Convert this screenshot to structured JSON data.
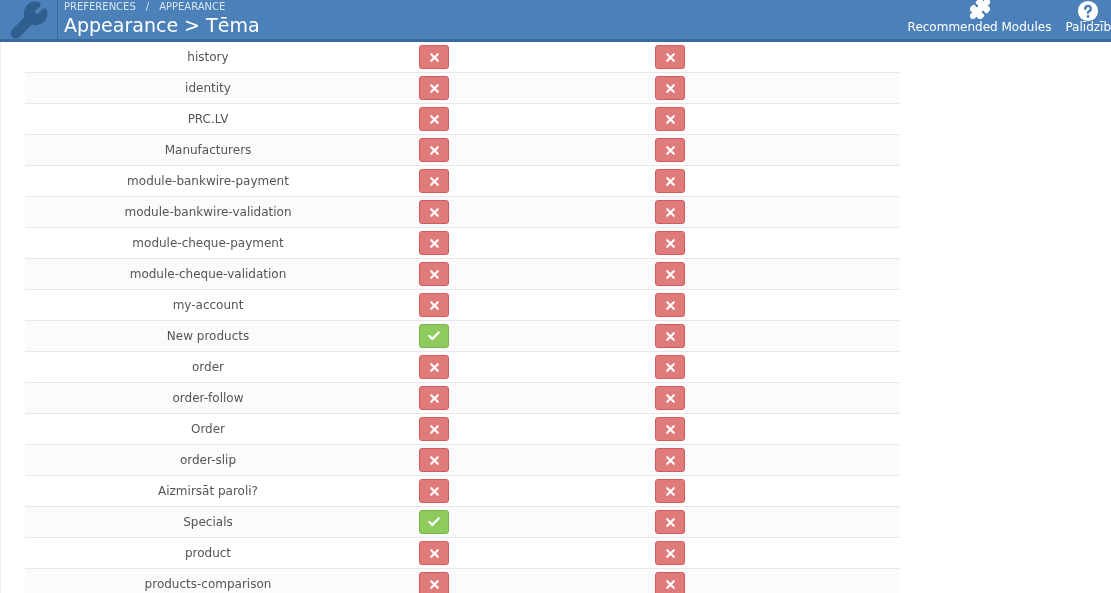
{
  "header": {
    "breadcrumb": [
      "PREFERENCES",
      "/",
      "APPEARANCE"
    ],
    "title": "Appearance > Tēma",
    "actions": [
      {
        "kind": "modules",
        "label": "Recommended Modules"
      },
      {
        "kind": "help",
        "label": "Palīdzīb"
      }
    ]
  },
  "rows": [
    {
      "name": "history",
      "toggles": [
        {
          "on": false
        },
        {
          "on": false
        }
      ]
    },
    {
      "name": "identity",
      "toggles": [
        {
          "on": false
        },
        {
          "on": false
        }
      ]
    },
    {
      "name": "PRC.LV",
      "toggles": [
        {
          "on": false
        },
        {
          "on": false
        }
      ]
    },
    {
      "name": "Manufacturers",
      "toggles": [
        {
          "on": false
        },
        {
          "on": false
        }
      ]
    },
    {
      "name": "module-bankwire-payment",
      "toggles": [
        {
          "on": false
        },
        {
          "on": false
        }
      ]
    },
    {
      "name": "module-bankwire-validation",
      "toggles": [
        {
          "on": false
        },
        {
          "on": false
        }
      ]
    },
    {
      "name": "module-cheque-payment",
      "toggles": [
        {
          "on": false
        },
        {
          "on": false
        }
      ]
    },
    {
      "name": "module-cheque-validation",
      "toggles": [
        {
          "on": false
        },
        {
          "on": false
        }
      ]
    },
    {
      "name": "my-account",
      "toggles": [
        {
          "on": false
        },
        {
          "on": false
        }
      ]
    },
    {
      "name": "New products",
      "toggles": [
        {
          "on": true
        },
        {
          "on": false
        }
      ]
    },
    {
      "name": "order",
      "toggles": [
        {
          "on": false
        },
        {
          "on": false
        }
      ]
    },
    {
      "name": "order-follow",
      "toggles": [
        {
          "on": false
        },
        {
          "on": false
        }
      ]
    },
    {
      "name": "Order",
      "toggles": [
        {
          "on": false
        },
        {
          "on": false
        }
      ]
    },
    {
      "name": "order-slip",
      "toggles": [
        {
          "on": false
        },
        {
          "on": false
        }
      ]
    },
    {
      "name": "Aizmirsāt paroli?",
      "toggles": [
        {
          "on": false
        },
        {
          "on": false
        }
      ]
    },
    {
      "name": "Specials",
      "toggles": [
        {
          "on": true
        },
        {
          "on": false
        }
      ]
    },
    {
      "name": "product",
      "toggles": [
        {
          "on": false
        },
        {
          "on": false
        }
      ]
    },
    {
      "name": "products-comparison",
      "toggles": [
        {
          "on": false
        },
        {
          "on": false
        }
      ]
    }
  ]
}
